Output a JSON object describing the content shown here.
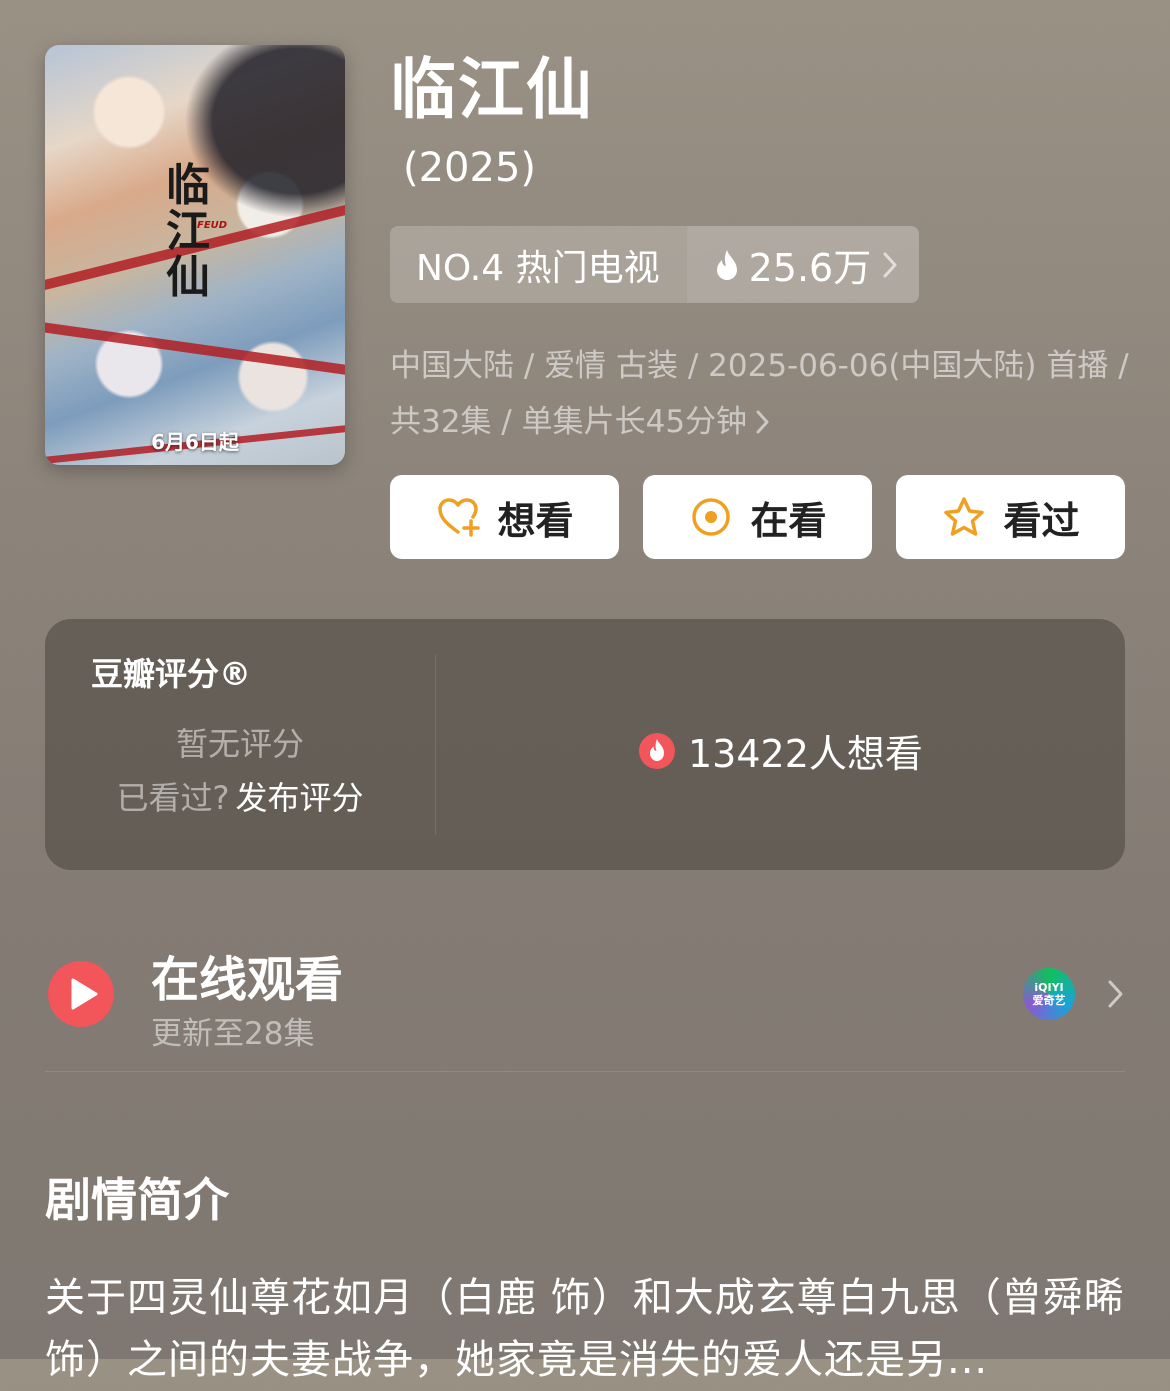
{
  "poster": {
    "calligraphy": "临江仙",
    "subtitle_en": "FEUD",
    "date_tag": "6月6日起"
  },
  "title": "临江仙",
  "year": "(2025)",
  "rank": {
    "label": "NO.4 热门电视",
    "heat": "25.6万"
  },
  "meta": {
    "line": "中国大陆 / 爱情 古装 / 2025-06-06(中国大陆) 首播 / 共32集 / 单集片长45分钟"
  },
  "actions": {
    "want": "想看",
    "watching": "在看",
    "watched": "看过"
  },
  "rating": {
    "title": "豆瓣评分®",
    "no_rating": "暂无评分",
    "watched_question": "已看过?",
    "publish": "发布评分",
    "wish_count": "13422人想看"
  },
  "online": {
    "title": "在线观看",
    "subtitle": "更新至28集",
    "provider_line1": "iQIYI",
    "provider_line2": "爱奇艺"
  },
  "synopsis": {
    "title": "剧情简介",
    "text": "关于四灵仙尊花如月（白鹿 饰）和大成玄尊白九思（曾舜晞 饰）之间的夫妻战争，她家竟是消失的爱人还是另..."
  },
  "colors": {
    "accent_orange": "#f0a020",
    "play_red": "#f2555a",
    "flame_red": "#f2555a"
  }
}
